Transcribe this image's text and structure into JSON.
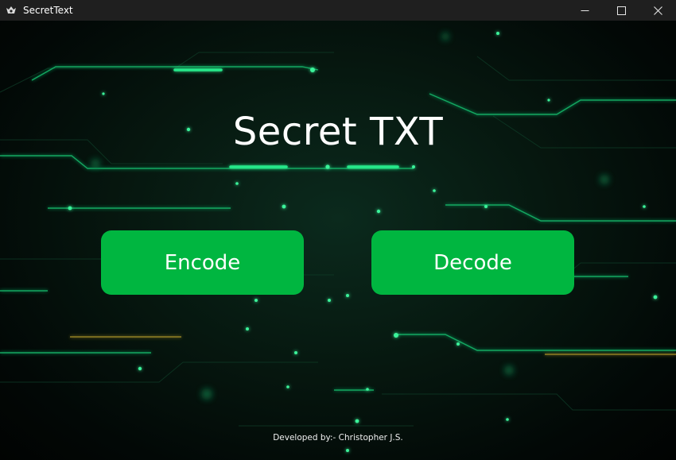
{
  "window": {
    "title": "SecretText",
    "controls": [
      "minimize-icon",
      "maximize-icon",
      "close-icon"
    ]
  },
  "main": {
    "heading": "Secret TXT",
    "encode_label": "Encode",
    "decode_label": "Decode",
    "footer": "Developed by:- Christopher J.S."
  },
  "colors": {
    "button_bg": "#00b640",
    "titlebar_bg": "#1f1f1f",
    "circuit_green": "#16d27a",
    "text": "#ffffff"
  }
}
